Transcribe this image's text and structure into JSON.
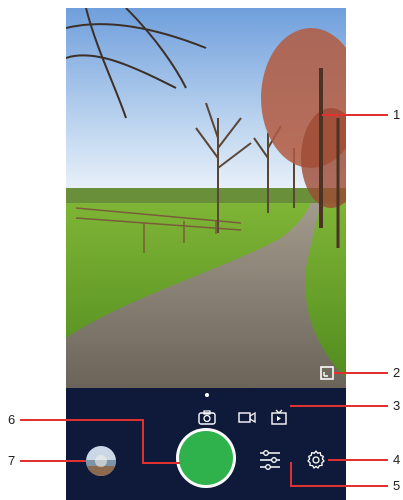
{
  "camera": {
    "modes": [
      {
        "name": "photo",
        "icon": "camera-icon",
        "active": true
      },
      {
        "name": "video",
        "icon": "video-icon",
        "active": false
      },
      {
        "name": "timelapse",
        "icon": "timelapse-icon",
        "active": false
      }
    ],
    "colors": {
      "panel": "#0f1a3a",
      "shutter": "#2fb24c",
      "callout": "#e03030"
    }
  },
  "callouts": {
    "c1": "1",
    "c2": "2",
    "c3": "3",
    "c4": "4",
    "c5": "5",
    "c6": "6",
    "c7": "7"
  }
}
